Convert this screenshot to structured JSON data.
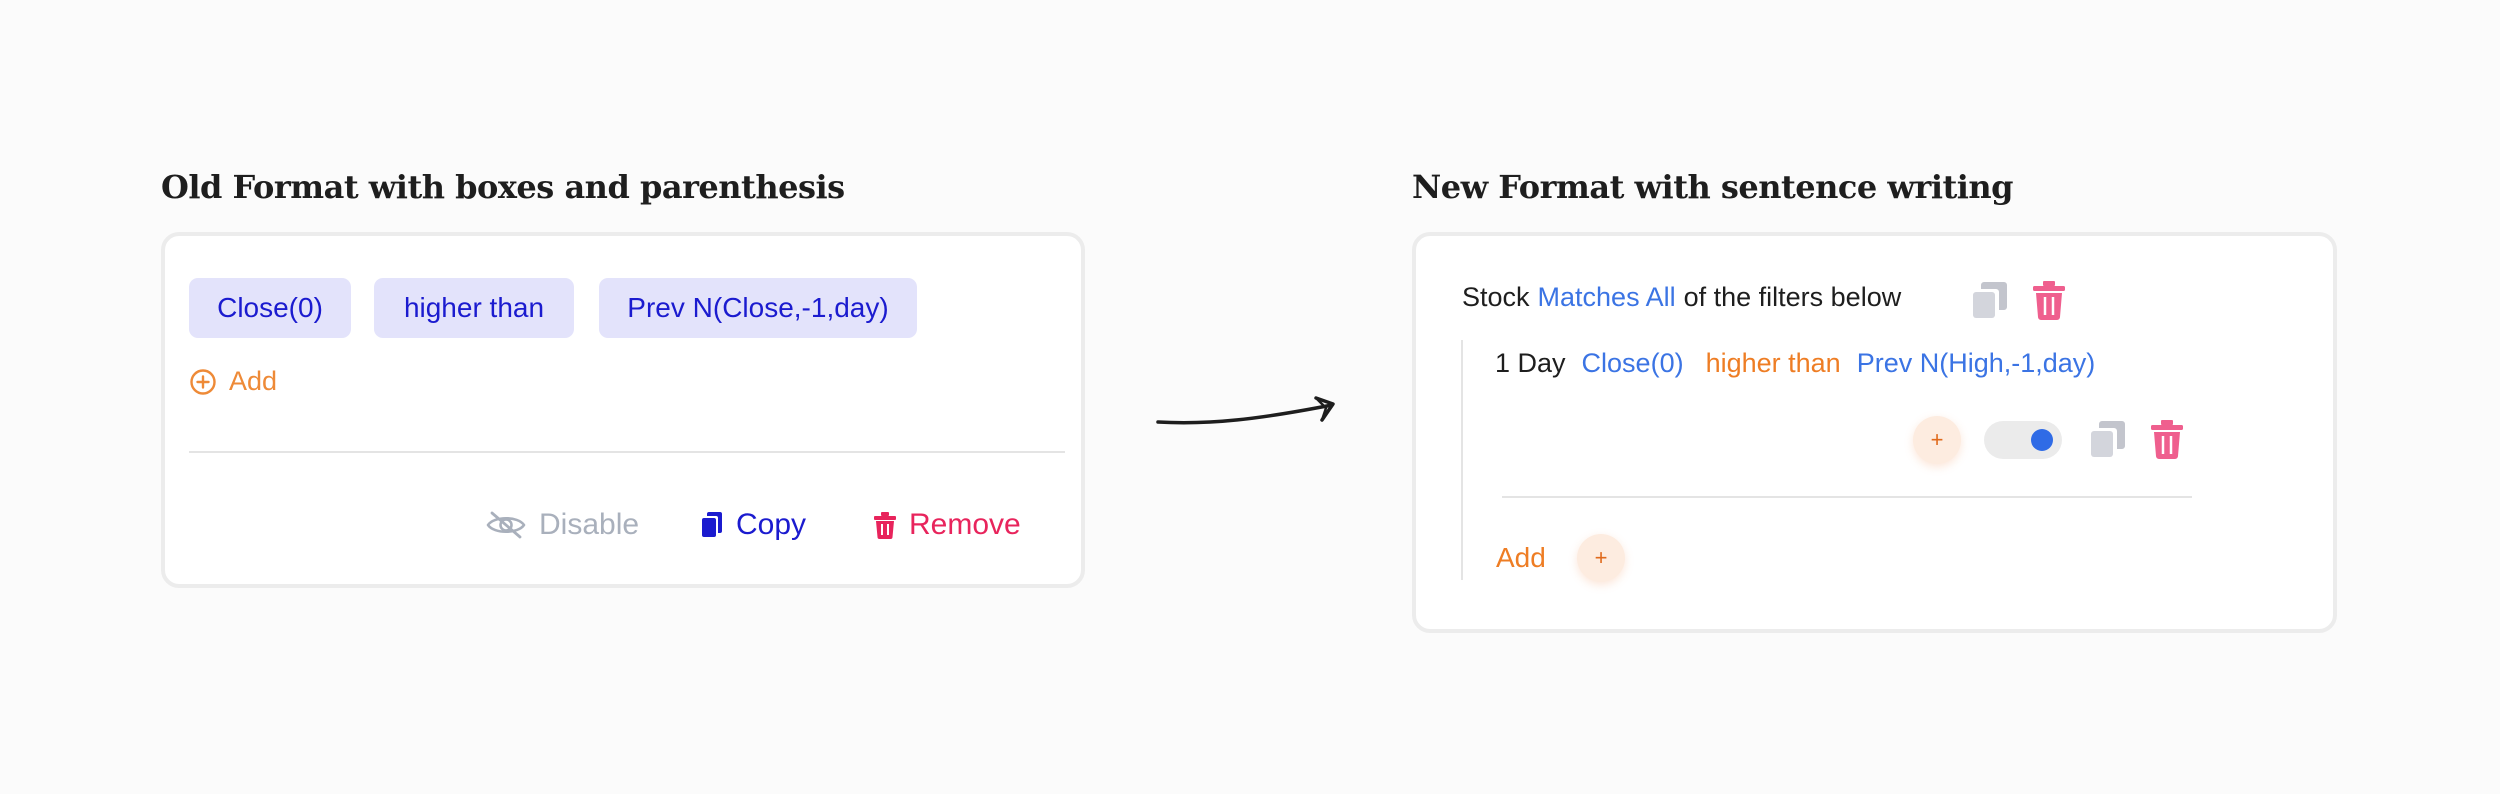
{
  "old_format": {
    "title": "Old Format with boxes and parenthesis",
    "chips": [
      "Close(0)",
      "higher than",
      "Prev N(Close,-1,day)"
    ],
    "add_label": "Add",
    "actions": {
      "disable": "Disable",
      "copy": "Copy",
      "remove": "Remove"
    }
  },
  "new_format": {
    "title": "New Format with sentence writing",
    "header": {
      "prefix": "Stock",
      "match_mode": "Matches All",
      "suffix": "of the filters below"
    },
    "filter": {
      "timeframe": "1 Day",
      "indicator": "Close(0)",
      "operator": "higher than",
      "comparison": "Prev N(High,-1,day)"
    },
    "add_label": "Add",
    "plus_symbol": "+",
    "toggle_enabled": true
  },
  "colors": {
    "chip_bg": "#e3e3fb",
    "chip_text": "#1b1bcf",
    "orange": "#ee8a37",
    "blue_link": "#3b74e4",
    "red": "#e8245c",
    "pink_trash": "#ef5f8e",
    "gray": "#a9b0bc"
  }
}
